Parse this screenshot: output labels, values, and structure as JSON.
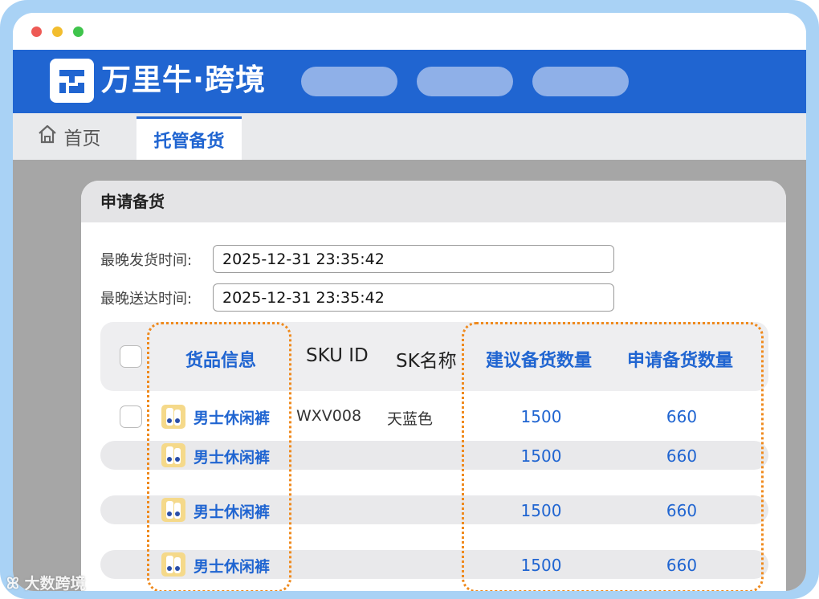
{
  "window": {
    "brand_name": "万里牛·跨境",
    "nav_pills": [
      "",
      "",
      ""
    ]
  },
  "tabs": {
    "home_label": "首页",
    "active_label": "托管备货"
  },
  "card": {
    "title": "申请备货",
    "form": {
      "ship_label": "最晚发货时间:",
      "ship_value": "2025-12-31 23:35:42",
      "deliver_label": "最晚送达时间:",
      "deliver_value": "2025-12-31 23:35:42"
    },
    "table": {
      "columns": [
        "货品信息",
        "SKU ID",
        "SK名称",
        "建议备货数量",
        "申请备货数量"
      ],
      "rows": [
        {
          "product": "男士休闲裤",
          "sku_id": "WXV008",
          "sku_name": "天蓝色",
          "suggested": "1500",
          "requested": "660"
        },
        {
          "product": "男士休闲裤",
          "sku_id": "",
          "sku_name": "",
          "suggested": "1500",
          "requested": "660"
        },
        {
          "product": "男士休闲裤",
          "sku_id": "",
          "sku_name": "",
          "suggested": "1500",
          "requested": "660"
        },
        {
          "product": "男士休闲裤",
          "sku_id": "",
          "sku_name": "",
          "suggested": "1500",
          "requested": "660"
        }
      ]
    }
  },
  "watermark": "大数跨境",
  "colors": {
    "brand_blue": "#2065d1",
    "frame_blue": "#a9d2f5",
    "highlight_orange": "#ef8a1e"
  },
  "icons": {
    "logo": "wanliniu-logo-icon",
    "home": "home-icon",
    "product": "product-thumbnail-icon"
  }
}
